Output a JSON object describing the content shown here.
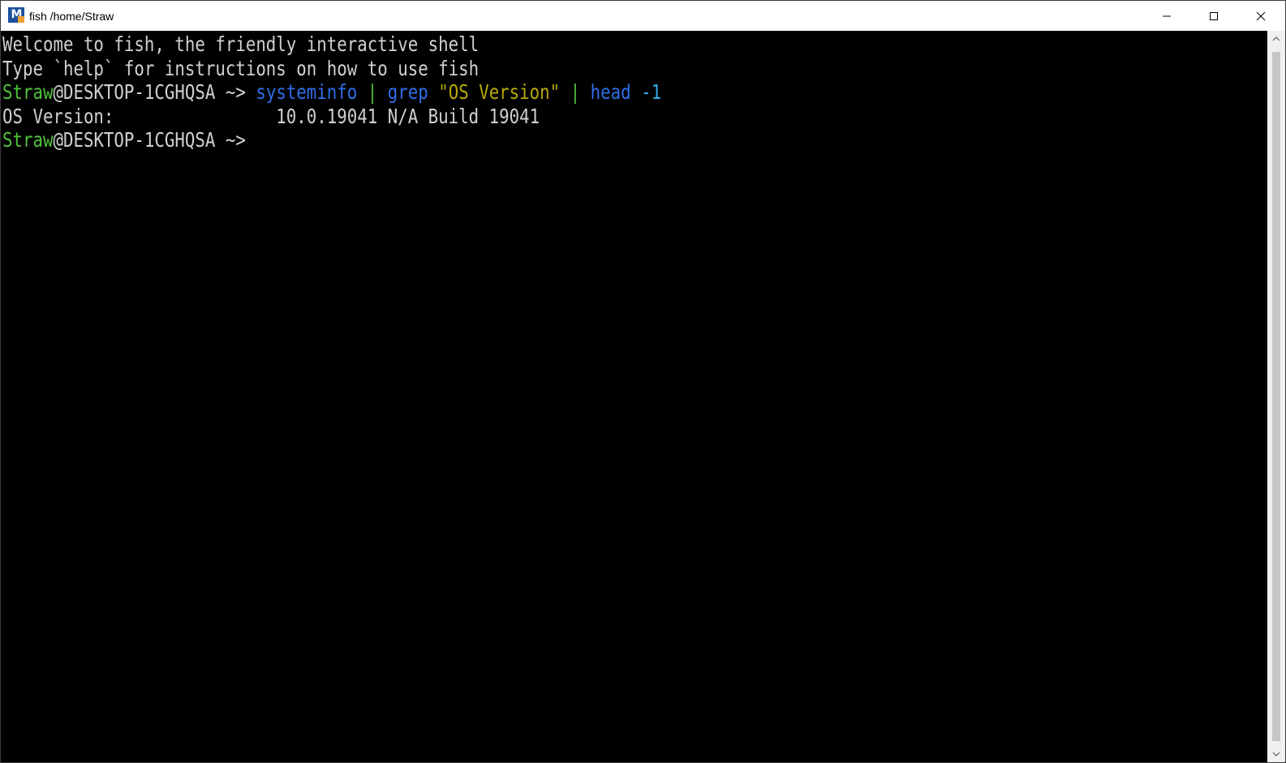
{
  "window": {
    "title": "fish /home/Straw",
    "icon_label": "M"
  },
  "window_controls": {
    "minimize": "minimize-icon",
    "maximize": "maximize-icon",
    "close": "close-icon"
  },
  "colors": {
    "prompt_user": "#4fc13a",
    "command": "#2f6ee6",
    "string": "#b8a80a",
    "option": "#36a9e6",
    "text": "#d0d0d0",
    "background": "#000000"
  },
  "terminal": {
    "welcome_line_1": "Welcome to fish, the friendly interactive shell",
    "welcome_line_2": "Type `help` for instructions on how to use fish",
    "prompt1": {
      "user": "Straw",
      "host": "@DESKTOP-1CGHQSA",
      "path": " ~>",
      "cmd_space": " ",
      "cmd_name": "systeminfo",
      "pipe1": " | ",
      "cmd_grep": "grep",
      "arg_space": " ",
      "arg_string": "\"OS Version\"",
      "pipe2": " | ",
      "cmd_head": "head",
      "opt_space": " ",
      "opt": "-1"
    },
    "output_line": "OS Version:                10.0.19041 N/A Build 19041",
    "prompt2": {
      "user": "Straw",
      "host": "@DESKTOP-1CGHQSA",
      "path": " ~>"
    }
  }
}
